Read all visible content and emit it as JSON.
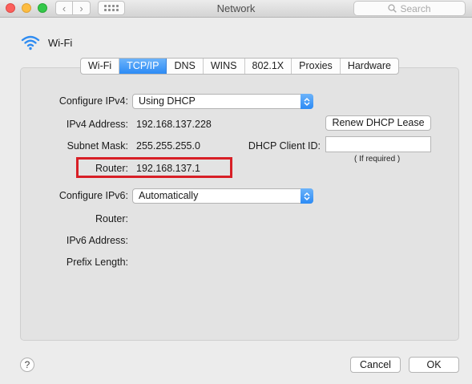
{
  "window": {
    "title": "Network",
    "search_placeholder": "Search",
    "back_glyph": "‹",
    "forward_glyph": "›"
  },
  "header": {
    "icon": "wifi-icon",
    "service_name": "Wi-Fi"
  },
  "tabs": [
    {
      "label": "Wi-Fi",
      "active": false
    },
    {
      "label": "TCP/IP",
      "active": true
    },
    {
      "label": "DNS",
      "active": false
    },
    {
      "label": "WINS",
      "active": false
    },
    {
      "label": "802.1X",
      "active": false
    },
    {
      "label": "Proxies",
      "active": false
    },
    {
      "label": "Hardware",
      "active": false
    }
  ],
  "tcpip": {
    "configure_ipv4": {
      "label": "Configure IPv4:",
      "value": "Using DHCP"
    },
    "ipv4_address": {
      "label": "IPv4 Address:",
      "value": "192.168.137.228"
    },
    "subnet_mask": {
      "label": "Subnet Mask:",
      "value": "255.255.255.0"
    },
    "router": {
      "label": "Router:",
      "value": "192.168.137.1"
    },
    "renew_button": "Renew DHCP Lease",
    "dhcp_client_id": {
      "label": "DHCP Client ID:",
      "value": "",
      "hint": "( If required )"
    },
    "configure_ipv6": {
      "label": "Configure IPv6:",
      "value": "Automatically"
    },
    "router6": {
      "label": "Router:",
      "value": ""
    },
    "ipv6_address": {
      "label": "IPv6 Address:",
      "value": ""
    },
    "prefix_length": {
      "label": "Prefix Length:",
      "value": ""
    }
  },
  "footer": {
    "help_label": "?",
    "cancel_label": "Cancel",
    "ok_label": "OK"
  },
  "colors": {
    "accent": "#2c8bf5",
    "highlight_box": "#d81f26"
  }
}
